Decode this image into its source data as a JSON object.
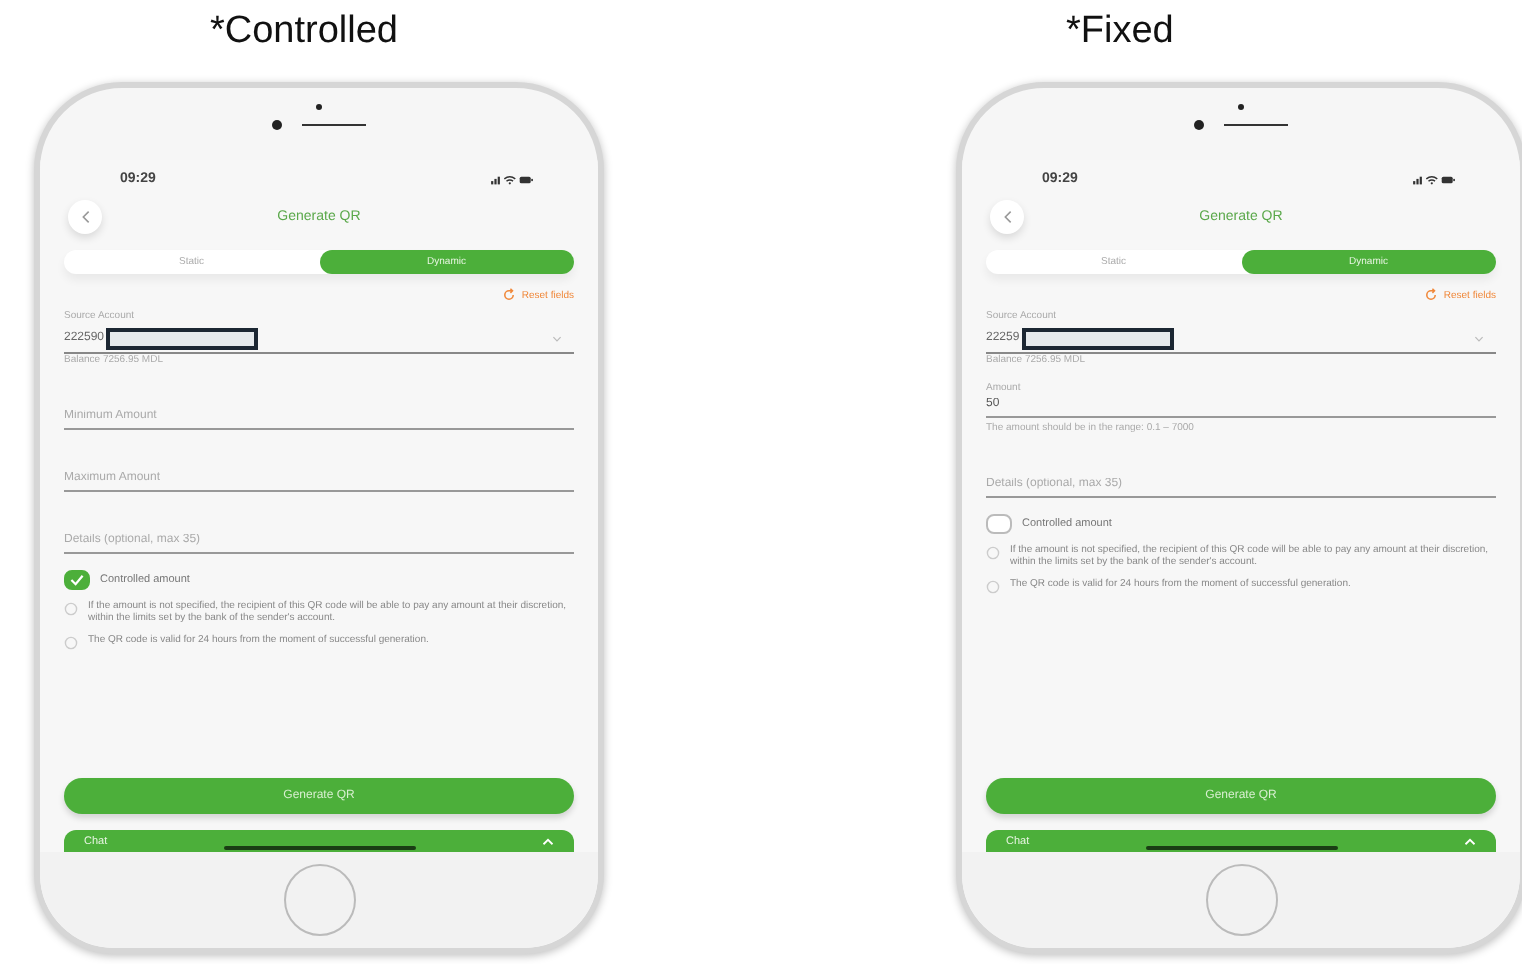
{
  "phones": [
    {
      "caption": "*Controlled",
      "time": "09:29",
      "title": "Generate QR",
      "tabs": [
        {
          "label": "Static",
          "selected": false
        },
        {
          "label": "Dynamic",
          "selected": true
        }
      ],
      "reset_label": "Reset fields",
      "account": {
        "label": "Source Account",
        "number": "222590",
        "balance": "Balance 7256.95 MDL"
      },
      "fields": [
        {
          "kind": "empty",
          "placeholder": "Minimum Amount"
        },
        {
          "kind": "empty",
          "placeholder": "Maximum Amount"
        },
        {
          "kind": "empty",
          "placeholder": "Details (optional, max 35)"
        }
      ],
      "checkbox": {
        "label": "Controlled amount",
        "checked": true
      },
      "notes": [
        "If the amount is not specified, the recipient of this QR code will be able to pay any amount at their discretion, within the limits set by the bank of the sender's account.",
        "The QR code is valid for 24 hours from the moment of successful generation."
      ],
      "button": "Generate QR",
      "chat": "Chat"
    },
    {
      "caption": "*Fixed",
      "time": "09:29",
      "title": "Generate QR",
      "tabs": [
        {
          "label": "Static",
          "selected": false
        },
        {
          "label": "Dynamic",
          "selected": true
        }
      ],
      "reset_label": "Reset fields",
      "account": {
        "label": "Source Account",
        "number": "22259",
        "balance": "Balance 7256.95 MDL"
      },
      "fields": [
        {
          "kind": "filled",
          "label": "Amount",
          "value": "50",
          "hint": "The amount should be in the range: 0.1 – 7000"
        },
        {
          "kind": "empty",
          "placeholder": "Details (optional, max 35)"
        }
      ],
      "checkbox": {
        "label": "Controlled amount",
        "checked": false
      },
      "notes": [
        "If the amount is not specified, the recipient of this QR code will be able to pay any amount at their discretion, within the limits set by the bank of the sender's account.",
        "The QR code is valid for 24 hours from the moment of successful generation."
      ],
      "button": "Generate QR",
      "chat": "Chat"
    }
  ]
}
